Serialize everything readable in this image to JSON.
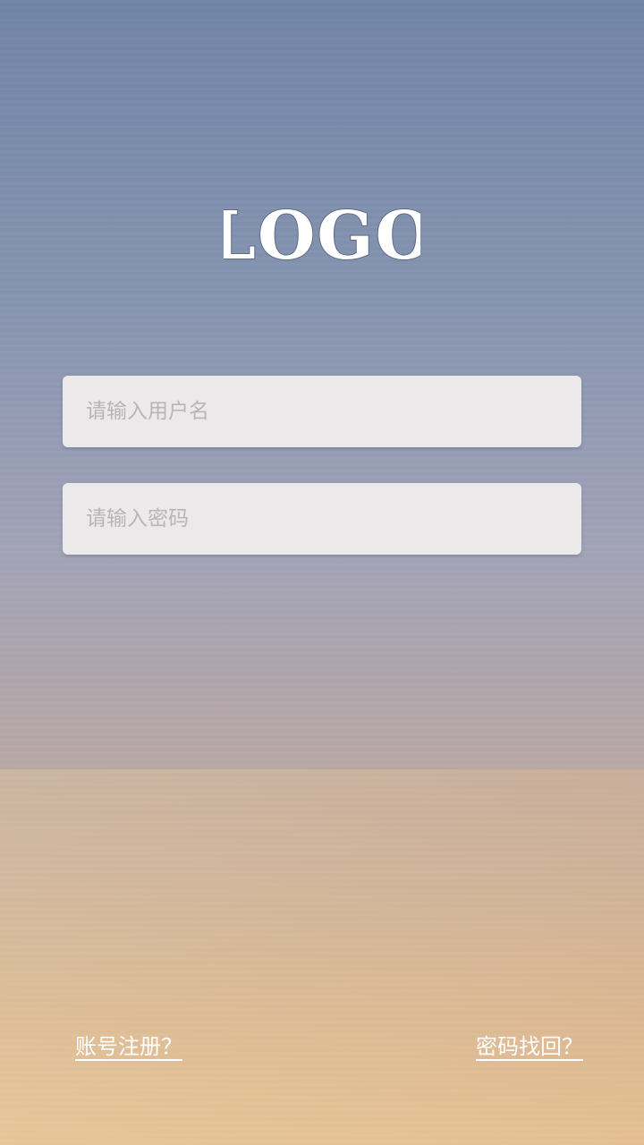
{
  "logo": {
    "text": "LOGO"
  },
  "login_form": {
    "username_placeholder": "请输入用户名",
    "password_placeholder": "请输入密码"
  },
  "links": {
    "register": "账号注册？",
    "forgot_password": "密码找回？"
  },
  "colors": {
    "background_top": "#7185a8",
    "background_bottom": "#e6c49a",
    "input_background": "#ebe9ea",
    "placeholder_text": "#b7b5b6",
    "link_text": "#ffffff"
  }
}
